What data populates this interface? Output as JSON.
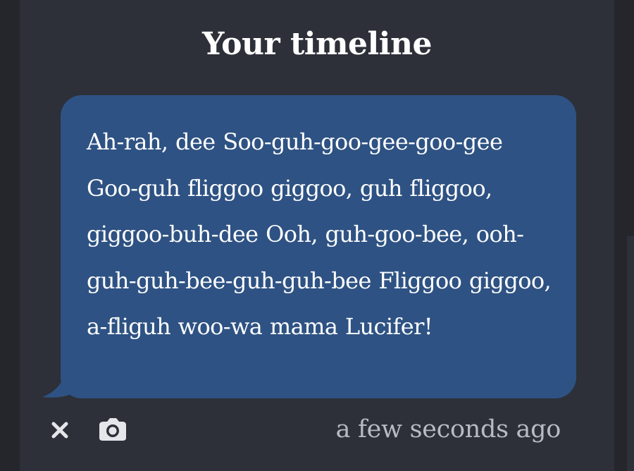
{
  "header": {
    "title": "Your timeline"
  },
  "message": {
    "text": "Ah-rah, dee Soo-guh-goo-gee-goo-gee Goo-guh fliggoo giggoo, guh fliggoo, giggoo-buh-dee Ooh, guh-goo-bee, ooh-guh-guh-bee-guh-guh-bee Fliggoo giggoo, a-fliguh woo-wa mama Lucifer!",
    "timestamp": "a few seconds ago"
  },
  "actions": {
    "delete_icon": "close-icon",
    "camera_icon": "camera-icon"
  },
  "colors": {
    "page_background": "#24262c",
    "panel_background": "#2d3039",
    "bubble_background": "#2e5283",
    "text": "#ffffff",
    "timestamp": "#b8bbc2"
  }
}
